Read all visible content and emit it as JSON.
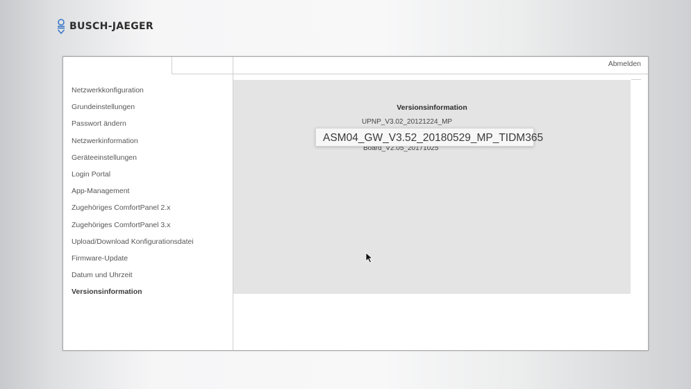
{
  "brand": {
    "name": "BUSCH-JAEGER"
  },
  "header": {
    "logout_label": "Abmelden"
  },
  "sidebar": {
    "items": [
      {
        "label": "Netzwerkkonfiguration"
      },
      {
        "label": "Grundeinstellungen"
      },
      {
        "label": "Passwort ändern"
      },
      {
        "label": "Netzwerkinformation"
      },
      {
        "label": "Geräteeinstellungen"
      },
      {
        "label": "Login Portal"
      },
      {
        "label": "App-Management"
      },
      {
        "label": "Zugehöriges ComfortPanel 2.x"
      },
      {
        "label": "Zugehöriges ComfortPanel 3.x"
      },
      {
        "label": "Upload/Download Konfigurationsdatei"
      },
      {
        "label": "Firmware-Update"
      },
      {
        "label": "Datum und Uhrzeit"
      },
      {
        "label": "Versionsinformation"
      }
    ],
    "active_index": 12
  },
  "main": {
    "title": "Versionsinformation",
    "versions": [
      "UPNP_V3.02_20121224_MP",
      "ASM04_GW_V3.52_20180529_MP_TIDM365",
      "Board_V2.05_20171025"
    ]
  },
  "tooltip": {
    "text": "ASM04_GW_V3.52_20180529_MP_TIDM365"
  },
  "colors": {
    "content_bg": "#e4e4e4",
    "brand_blue": "#3a78c9"
  }
}
